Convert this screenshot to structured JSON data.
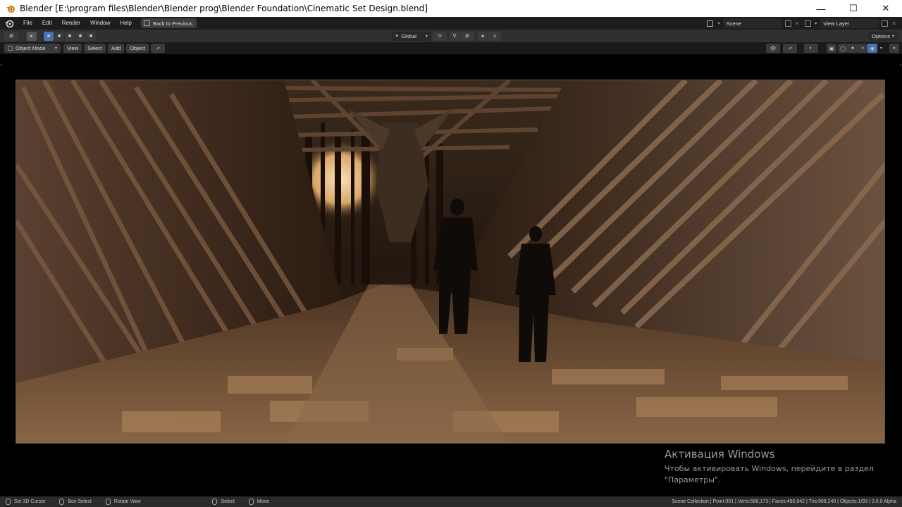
{
  "window": {
    "title": "Blender [E:\\program files\\Blender\\Blender prog\\Blender Foundation\\Cinematic Set Design.blend]",
    "controls": [
      "—",
      "☐",
      "✕"
    ]
  },
  "topbar": {
    "menus": [
      "File",
      "Edit",
      "Render",
      "Window",
      "Help"
    ],
    "back_label": "Back to Previous",
    "scene": "Scene",
    "view_layer": "View Layer"
  },
  "header1": {
    "transform_orientation": "Global",
    "options_label": "Options"
  },
  "header2": {
    "mode": "Object Mode",
    "menus": [
      "View",
      "Select",
      "Add",
      "Object"
    ]
  },
  "activation": {
    "title": "Активация Windows",
    "line1": "Чтобы активировать Windows, перейдите в раздел",
    "line2": "\"Параметры\"."
  },
  "statusbar": {
    "hints": [
      "Set 3D Cursor",
      "Box Select",
      "Rotate View",
      "Select",
      "Move"
    ],
    "stats": "Scene Collection | Point.001 | Verts:586,173 | Faces:460,842 | Tris:908,240 | Objects:1/93 | 3.0.0 Alpha"
  },
  "colors": {
    "accent": "#4772b3",
    "header": "#303030",
    "topbar": "#1d1d1d",
    "statusbar": "#2b2b2b"
  }
}
